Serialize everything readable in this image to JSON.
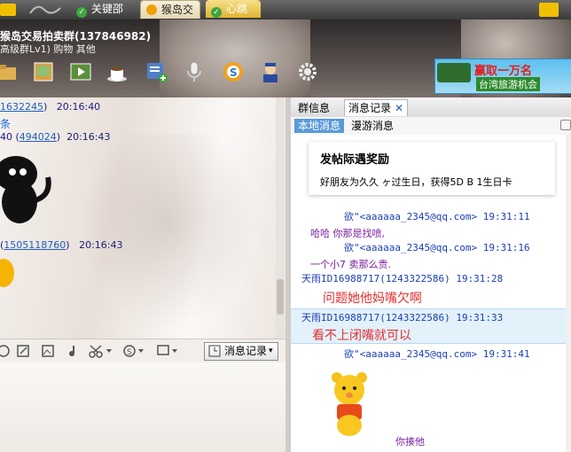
{
  "tabs": [
    {
      "label": "关键邵",
      "icon": "check-status-icon"
    },
    {
      "label": "猴岛交",
      "icon": "qq-penguin-icon"
    },
    {
      "label": "心跳",
      "icon": "check-status-icon"
    }
  ],
  "header": {
    "group_title": "猴岛交易拍卖群(137846982)",
    "group_sub": "高级群Lv1) 购物 其他",
    "toolbar_icons": [
      "folder-icon",
      "photo-album-icon",
      "video-icon",
      "coffee-icon",
      "group-add-icon",
      "microphone-icon",
      "s-logo-icon",
      "police-icon",
      "settings-gear-icon"
    ],
    "ad": {
      "line1": "赢取一万名",
      "line2": "台湾旅游机会"
    }
  },
  "chat": {
    "messages": [
      {
        "id": "1632245",
        "time": "20:16:40"
      },
      {
        "prefix": "40",
        "id": "494024",
        "time": "20:16:43"
      },
      {
        "id": "1505118760",
        "time": "20:16:43"
      }
    ],
    "history_button": "消息记录"
  },
  "right": {
    "tabs": [
      "群信息",
      "消息记录"
    ],
    "subtabs": [
      "本地消息",
      "漫游消息"
    ],
    "card": {
      "title": "发帖际遇奖励",
      "body": "好朋友为久久    ヶ过生日，获得5D B 1生日卡"
    },
    "messages": [
      {
        "header": "欲\"<aaaaaa_2345@qq.com> 19:31:11",
        "body": "哈哈 你那是找喷,",
        "style": "body"
      },
      {
        "header": "欲\"<aaaaaa_2345@qq.com> 19:31:16",
        "body": "一个小7 卖那么贵.",
        "style": "body"
      },
      {
        "header": "天雨ID16988717(1243322586) 19:31:28",
        "body": "问题她他妈嘴欠啊",
        "style": "big"
      },
      {
        "header": "天雨ID16988717(1243322586) 19:31:33",
        "body": "看不上闭嘴就可以",
        "style": "big"
      },
      {
        "header": "欲\"<aaaaaa_2345@qq.com> 19:31:41",
        "body": "你揍他",
        "style": "body"
      }
    ]
  }
}
